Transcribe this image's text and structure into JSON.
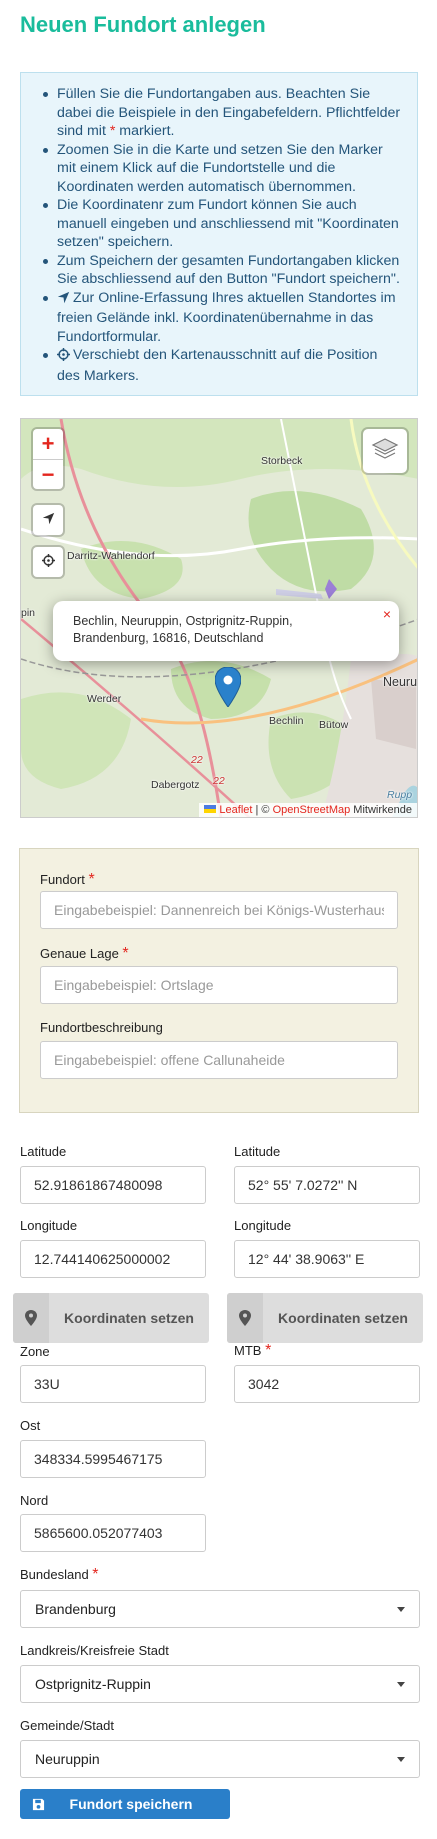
{
  "page": {
    "title": "Neuen Fundort anlegen"
  },
  "info": {
    "item1_a": "Füllen Sie die Fundortangaben aus. Beachten Sie dabei die Beispiele in den Eingabefeldern. Pflichtfelder sind mit ",
    "item1_star": "*",
    "item1_b": " markiert.",
    "item2": "Zoomen Sie in die Karte und setzen Sie den Marker mit einem Klick auf die Fundortstelle und die Koordinaten werden automatisch übernommen.",
    "item3": "Die Koordinatenr zum Fundort können Sie auch manuell eingeben und anschliessend mit \"Koordinaten setzen\" speichern.",
    "item4": "Zum Speichern der gesamten Fundortangaben klicken Sie abschliessend auf den Button \"Fundort speichern\".",
    "item5": "Zur Online-Erfassung Ihres aktuellen Standortes im freien Gelände inkl. Koordinatenübernahme in das Fundortformular.",
    "item6": "Verschiebt den Kartenausschnitt auf die Position des Markers."
  },
  "map": {
    "zoom_in": "+",
    "zoom_out": "−",
    "places": {
      "storbeck": "Storbeck",
      "darritz": "Darritz-Wahlendorf",
      "pin": "pin",
      "werder": "Werder",
      "bechlin": "Bechlin",
      "butow": "Bütow",
      "neuru": "Neuru",
      "dabergotz": "Dabergotz",
      "road1": "22",
      "road2": "22",
      "rupp": "Rupp"
    },
    "popup_line1": "Bechlin, Neuruppin, Ostprignitz-Ruppin,",
    "popup_line2": "Brandenburg, 16816, Deutschland",
    "popup_close": "×",
    "attribution_leaflet": "Leaflet",
    "attribution_sep": " | © ",
    "attribution_osm": "OpenStreetMap",
    "attribution_rest": " Mitwirkende",
    "icons": [
      "crosshair-icon",
      "location-arrow-icon",
      "layers-icon",
      "map-marker-icon"
    ]
  },
  "fundort_form": {
    "fundort_label": "Fundort",
    "fundort_required": "*",
    "fundort_placeholder": "Eingabebeispiel: Dannenreich bei Königs-Wusterhausen",
    "lage_label": "Genaue Lage",
    "lage_required": "*",
    "lage_placeholder": "Eingabebeispiel: Ortslage",
    "beschreibung_label": "Fundortbeschreibung",
    "beschreibung_placeholder": "Eingabebeispiel: offene Callunaheide"
  },
  "coords": {
    "lat_label_left": "Latitude",
    "lat_value_left": "52.91861867480098",
    "lat_label_right": "Latitude",
    "lat_value_right": "52° 55' 7.0272'' N",
    "lon_label_left": "Longitude",
    "lon_value_left": "12.744140625000002",
    "lon_label_right": "Longitude",
    "lon_value_right": "12° 44' 38.9063'' E",
    "set_button_left": "Koordinaten setzen",
    "set_button_right": "Koordinaten setzen",
    "zone_label": "Zone",
    "zone_value": "33U",
    "mtb_label": "MTB",
    "mtb_required": "*",
    "mtb_value": "3042",
    "ost_label": "Ost",
    "ost_value": "348334.5995467175",
    "nord_label": "Nord",
    "nord_value": "5865600.052077403"
  },
  "admin": {
    "bundesland_label": "Bundesland",
    "bundesland_required": "*",
    "bundesland_value": "Brandenburg",
    "landkreis_label": "Landkreis/Kreisfreie Stadt",
    "landkreis_value": "Ostprignitz-Ruppin",
    "gemeinde_label": "Gemeinde/Stadt",
    "gemeinde_value": "Neuruppin"
  },
  "save_button": "Fundort speichern",
  "colors": {
    "title": "#1abc9c",
    "required": "#e3261e",
    "primary": "#2a7fc9",
    "marker": "#2a81cb"
  }
}
